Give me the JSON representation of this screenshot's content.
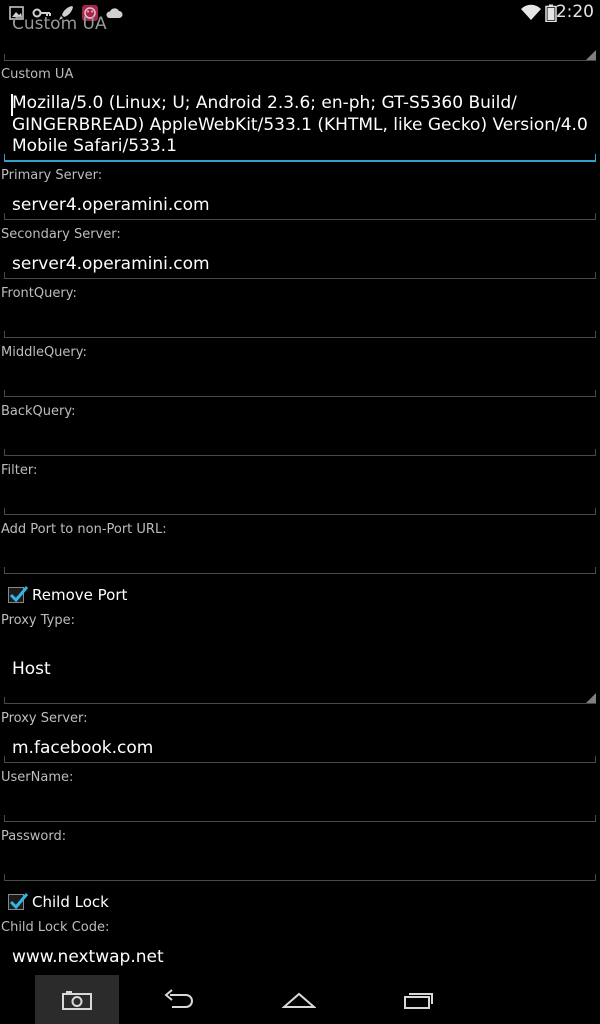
{
  "status_bar": {
    "time": "2:20",
    "icons": [
      "gallery-icon",
      "key-icon",
      "rocket-icon",
      "app-icon",
      "cloud-icon",
      "wifi-icon",
      "battery-icon"
    ]
  },
  "settings": {
    "top_spinner_value": "Custom UA",
    "custom_ua": {
      "label": "Custom UA",
      "lines": [
        "Mozilla/5.0 (Linux; U; Android 2.3.6; en-ph; GT-S5360 Build/",
        "GINGERBREAD) AppleWebKit/533.1 (KHTML, like Gecko) Version/4.0",
        "Mobile Safari/533.1"
      ]
    },
    "primary_server": {
      "label": "Primary Server:",
      "value": "server4.operamini.com"
    },
    "secondary_server": {
      "label": "Secondary Server:",
      "value": "server4.operamini.com"
    },
    "front_query": {
      "label": "FrontQuery:",
      "value": ""
    },
    "middle_query": {
      "label": "MiddleQuery:",
      "value": ""
    },
    "back_query": {
      "label": "BackQuery:",
      "value": ""
    },
    "filter": {
      "label": "Filter:",
      "value": ""
    },
    "add_port": {
      "label": "Add Port to non-Port URL:",
      "value": ""
    },
    "remove_port": {
      "label": "Remove Port",
      "checked": true
    },
    "proxy_type": {
      "label": "Proxy Type:",
      "value": "Host"
    },
    "proxy_server": {
      "label": "Proxy Server:",
      "value": "m.facebook.com"
    },
    "username": {
      "label": "UserName:",
      "value": ""
    },
    "password": {
      "label": "Password:",
      "value": ""
    },
    "child_lock": {
      "label": "Child Lock",
      "checked": true
    },
    "child_lock_code": {
      "label": "Child Lock Code:",
      "value": "www.nextwap.net"
    }
  },
  "colors": {
    "accent": "#33a0c8",
    "background": "#000000",
    "divider": "#4a4a4a",
    "label": "#bdbdbd"
  },
  "nav_bar": {
    "buttons": [
      "camera-icon",
      "back-icon",
      "home-icon",
      "recents-icon"
    ]
  }
}
